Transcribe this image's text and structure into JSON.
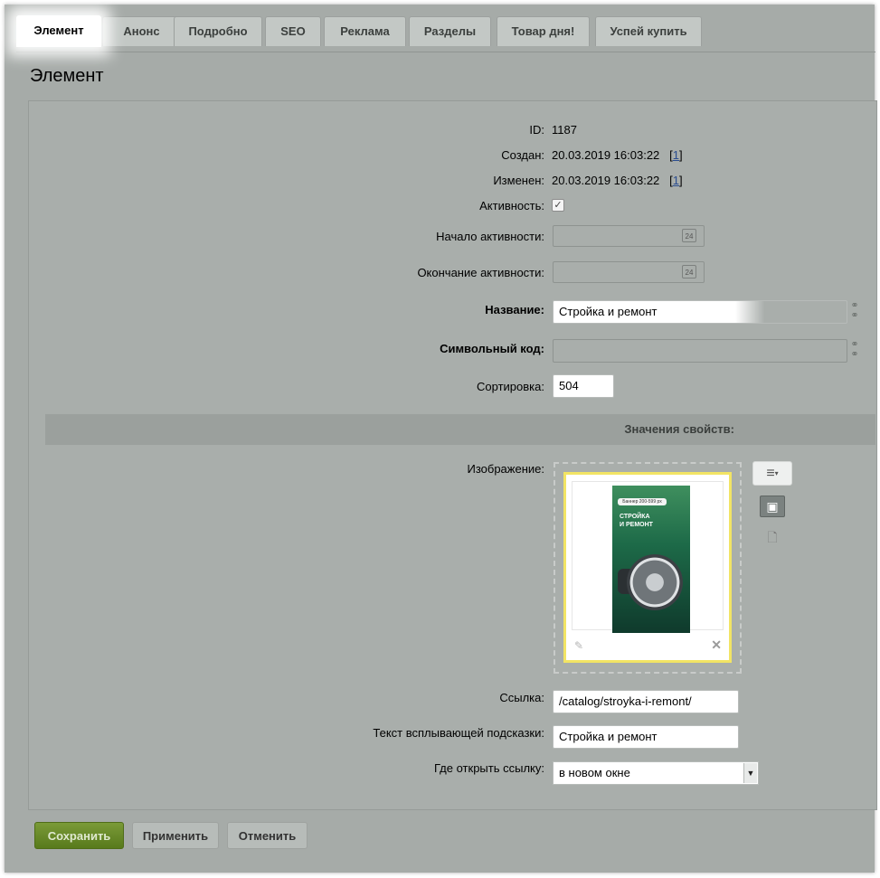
{
  "tabs": [
    "Элемент",
    "Анонс",
    "Подробно",
    "SEO",
    "Реклама",
    "Разделы",
    "Товар дня!",
    "Успей купить"
  ],
  "page_title": "Элемент",
  "fields": {
    "id_label": "ID:",
    "id_value": "1187",
    "created_label": "Создан:",
    "created_value": "20.03.2019 16:03:22",
    "created_link_open": "[",
    "created_link": "1",
    "created_link_close": "]",
    "modified_label": "Изменен:",
    "modified_value": "20.03.2019 16:03:22",
    "modified_link_open": "[",
    "modified_link": "1",
    "modified_link_close": "]",
    "active_label": "Активность:",
    "active_checked": true,
    "active_from_label": "Начало активности:",
    "active_to_label": "Окончание активности:",
    "name_label": "Название:",
    "name_value": "Стройка и ремонт",
    "code_label": "Символьный код:",
    "code_value": "",
    "sort_label": "Сортировка:",
    "sort_value": "504"
  },
  "properties": {
    "section_title": "Значения свойств:",
    "image_label": "Изображение:",
    "banner_price_text": "Баннер 200-599 px",
    "banner_title_line1": "СТРОЙКА",
    "banner_title_line2": "И РЕМОНТ",
    "link_label": "Ссылка:",
    "link_value": "/catalog/stroyka-i-remont/",
    "tooltip_label": "Текст всплывающей подсказки:",
    "tooltip_value": "Стройка и ремонт",
    "target_label": "Где открыть ссылку:",
    "target_value": "в новом окне",
    "calendar_day": "24"
  },
  "buttons": {
    "save": "Сохранить",
    "apply": "Применить",
    "cancel": "Отменить"
  },
  "colors": {
    "save_button": "#6a8a2a",
    "highlight": "#ffffff",
    "image_border": "#f2e464"
  }
}
